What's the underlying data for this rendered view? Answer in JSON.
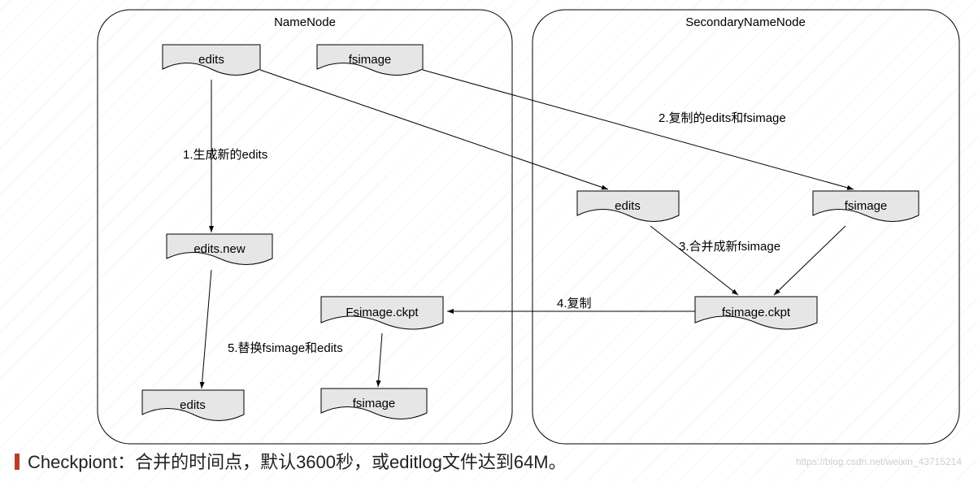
{
  "containers": {
    "left": {
      "title": "NameNode"
    },
    "right": {
      "title": "SecondaryNameNode"
    }
  },
  "nodes": {
    "edits_top": {
      "label": "edits"
    },
    "fsimage_top": {
      "label": "fsimage"
    },
    "edits_new": {
      "label": "edits.new"
    },
    "fsimage_ckpt_l": {
      "label": "Fsimage.ckpt"
    },
    "edits_bot": {
      "label": "edits"
    },
    "fsimage_bot": {
      "label": "fsimage"
    },
    "edits_r": {
      "label": "edits"
    },
    "fsimage_r": {
      "label": "fsimage"
    },
    "fsimage_ckpt_r": {
      "label": "fsimage.ckpt"
    }
  },
  "edges": {
    "e1": {
      "label": "1.生成新的edits"
    },
    "e2": {
      "label": "2.复制的edits和fsimage"
    },
    "e3": {
      "label": "3.合并成新fsimage"
    },
    "e4": {
      "label": "4.复制"
    },
    "e5": {
      "label": "5.替换fsimage和edits"
    }
  },
  "caption": "Checkpiont：合并的时间点，默认3600秒，或editlog文件达到64M。",
  "watermark": "https://blog.csdn.net/weixin_43715214"
}
